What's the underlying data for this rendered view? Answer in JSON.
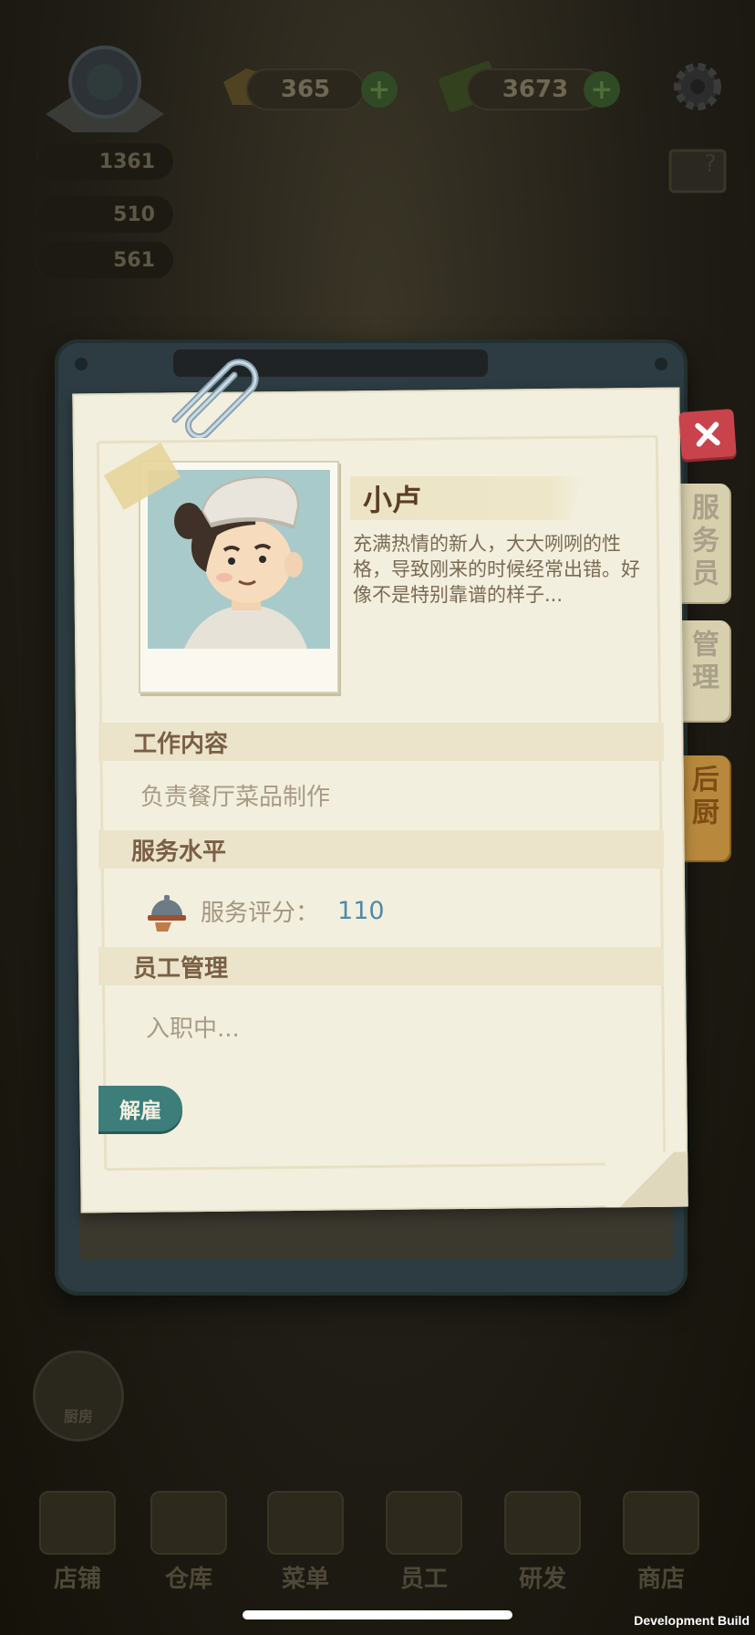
{
  "hud": {
    "currency_1": "365",
    "currency_2": "3673",
    "plus_symbol": "+",
    "stats": [
      "1361",
      "510",
      "561"
    ]
  },
  "bottom_nav": {
    "items": [
      {
        "label": "店铺",
        "icon": "shop-icon"
      },
      {
        "label": "仓库",
        "icon": "warehouse-icon"
      },
      {
        "label": "菜单",
        "icon": "menu-icon"
      },
      {
        "label": "员工",
        "icon": "staff-icon"
      },
      {
        "label": "研发",
        "icon": "research-icon"
      },
      {
        "label": "商店",
        "icon": "store-icon"
      }
    ],
    "round_button_label": "厨房"
  },
  "side_tabs": [
    {
      "label": "服务员",
      "active": false
    },
    {
      "label": "管理",
      "active": false
    },
    {
      "label": "后厨",
      "active": true
    }
  ],
  "staff": {
    "name": "小卢",
    "description": "充满热情的新人，大大咧咧的性格，导致刚来的时候经常出错。好像不是特别靠谱的样子...",
    "sections": {
      "work_title": "工作内容",
      "work_value": "负责餐厅菜品制作",
      "service_title": "服务水平",
      "rating_label": "服务评分：",
      "rating_value": "110",
      "manage_title": "员工管理",
      "manage_status": "入职中..."
    },
    "fire_button": "解雇"
  },
  "dev_build": "Development Build",
  "colors": {
    "accent_close": "#c9434c",
    "fire_button": "#3d7e7b",
    "rating_value": "#4f8aa8",
    "active_tab": "#b8893d"
  }
}
